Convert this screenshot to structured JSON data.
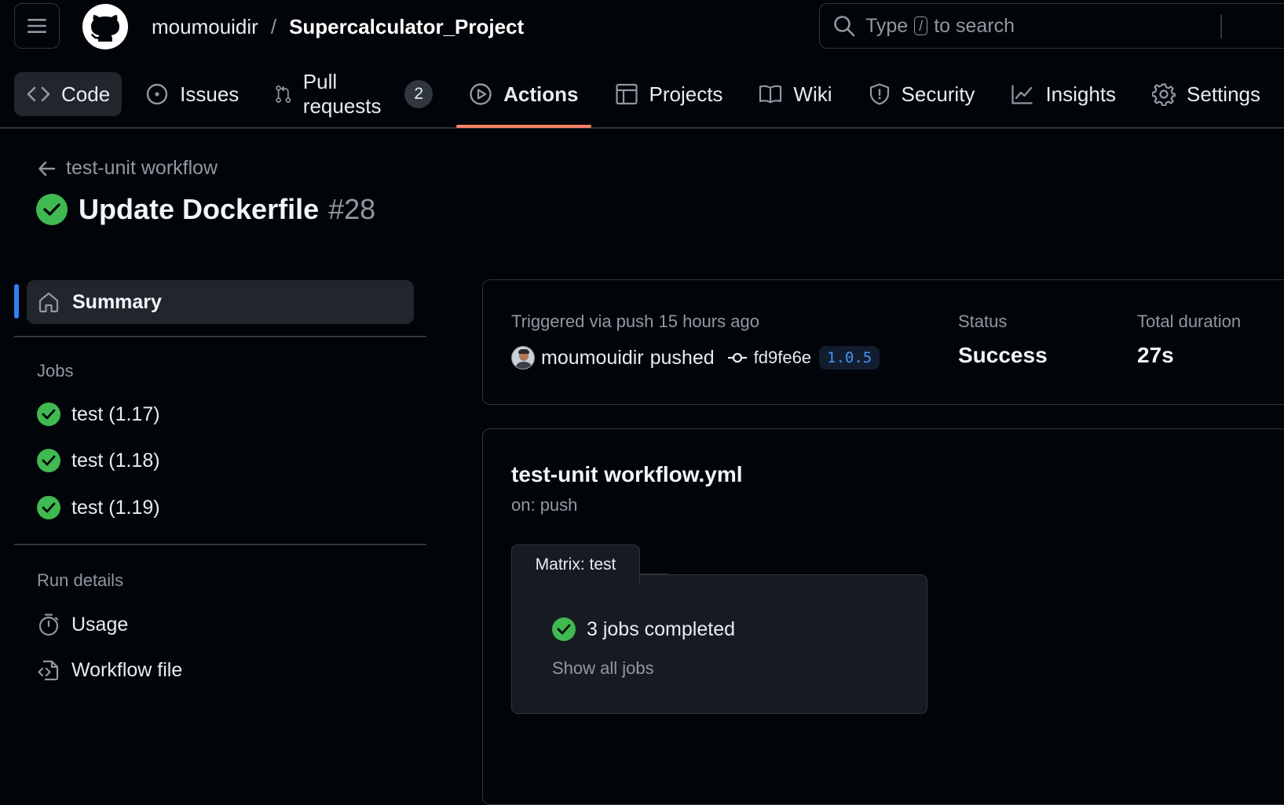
{
  "header": {
    "owner": "moumouidir",
    "separator": "/",
    "repo": "Supercalculator_Project",
    "search": {
      "prefix": "Type",
      "key": "/",
      "suffix": "to search"
    }
  },
  "tabs": [
    {
      "label": "Code",
      "icon": "code-icon"
    },
    {
      "label": "Issues",
      "icon": "issue-opened-icon"
    },
    {
      "label": "Pull requests",
      "icon": "git-pull-request-icon",
      "counter": "2"
    },
    {
      "label": "Actions",
      "icon": "play-icon",
      "active": true
    },
    {
      "label": "Projects",
      "icon": "table-icon"
    },
    {
      "label": "Wiki",
      "icon": "book-icon"
    },
    {
      "label": "Security",
      "icon": "shield-icon"
    },
    {
      "label": "Insights",
      "icon": "graph-icon"
    },
    {
      "label": "Settings",
      "icon": "gear-icon"
    }
  ],
  "run": {
    "workflow_link": "test-unit workflow",
    "title": "Update Dockerfile",
    "number": "#28",
    "status_color": "#3fb950"
  },
  "sidebar": {
    "summary_label": "Summary",
    "jobs_heading": "Jobs",
    "jobs": [
      {
        "label": "test (1.17)"
      },
      {
        "label": "test (1.18)"
      },
      {
        "label": "test (1.19)"
      }
    ],
    "run_details_heading": "Run details",
    "usage_label": "Usage",
    "workflow_file_label": "Workflow file"
  },
  "summary": {
    "triggered_text": "Triggered via push 15 hours ago",
    "actor": "moumouidir",
    "action": "pushed",
    "commit_sha": "fd9fe6e",
    "tag": "1.0.5",
    "status_label": "Status",
    "status_value": "Success",
    "duration_label": "Total duration",
    "duration_value": "27s"
  },
  "graph": {
    "workflow_file": "test-unit workflow.yml",
    "trigger": "on: push",
    "matrix_label": "Matrix: test",
    "jobs_completed": "3 jobs completed",
    "show_all": "Show all jobs"
  },
  "colors": {
    "accent_underline": "#f78166",
    "active_bar": "#2f81f7",
    "success": "#3fb950"
  }
}
